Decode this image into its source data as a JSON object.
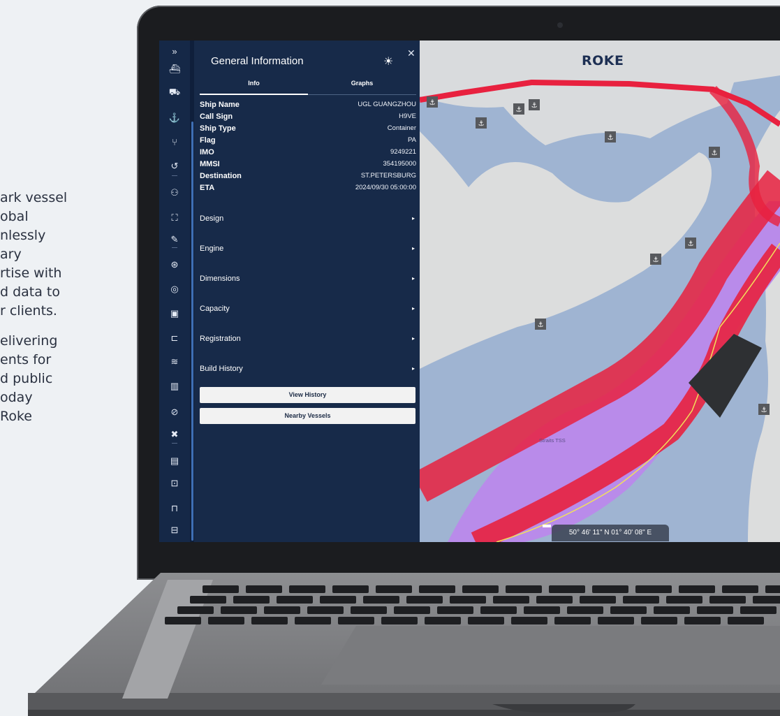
{
  "marketing": {
    "para1": [
      "ark vessel",
      "obal",
      "nlessly",
      "ary",
      "rtise with",
      "d data to",
      "r clients."
    ],
    "para2": [
      "elivering",
      "ents for",
      "d public",
      "oday",
      "Roke"
    ]
  },
  "sidebar": {
    "icons": [
      "expand-chevrons-icon",
      "ship-front-icon",
      "ship-icon",
      "anchor-icon",
      "route-split-icon",
      "history-icon",
      "people-icon",
      "fullscreen-icon",
      "pencil-icon",
      "satellite-icon",
      "radar-search-icon",
      "image-icon",
      "cast-icon",
      "waves-icon",
      "map-icon",
      "compass-icon",
      "tools-icon",
      "document-icon",
      "save-icon",
      "lock-icon",
      "feedback-icon"
    ],
    "expand_glyph": "»"
  },
  "panel": {
    "title": "General Information",
    "tabs": [
      "Info",
      "Graphs"
    ],
    "fields": [
      {
        "label": "Ship Name",
        "value": "UGL GUANGZHOU"
      },
      {
        "label": "Call Sign",
        "value": "H9VE"
      },
      {
        "label": "Ship Type",
        "value": "Container"
      },
      {
        "label": "Flag",
        "value": "PA"
      },
      {
        "label": "IMO",
        "value": "9249221"
      },
      {
        "label": "MMSI",
        "value": "354195000"
      },
      {
        "label": "Destination",
        "value": "ST.PETERSBURG"
      },
      {
        "label": "ETA",
        "value": "2024/09/30 05:00:00"
      }
    ],
    "sections": [
      "Design",
      "Engine",
      "Dimensions",
      "Capacity",
      "Registration",
      "Build History"
    ],
    "buttons": {
      "view_history": "View History",
      "nearby_vessels": "Nearby Vessels"
    }
  },
  "map": {
    "brand": "ROKE",
    "coordinates": "50° 46' 11\" N 01° 40' 08\" E",
    "area_label": "Straits TSS",
    "colors": {
      "sea": "#9fb4d2",
      "land": "#dcdddd",
      "density": "#e8213f",
      "tss_zone": "#b98bea",
      "track": "#f2e15a",
      "panel": "#172a49"
    }
  }
}
